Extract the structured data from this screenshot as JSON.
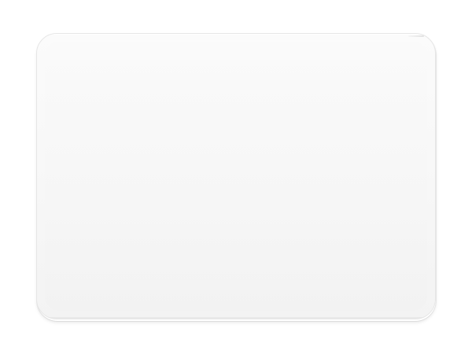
{
  "scene": {
    "background_color": "#ffffff",
    "object": {
      "type": "trackpad",
      "surface_color": "#f7f7f7",
      "edge_color": "#e6e6e6"
    }
  }
}
